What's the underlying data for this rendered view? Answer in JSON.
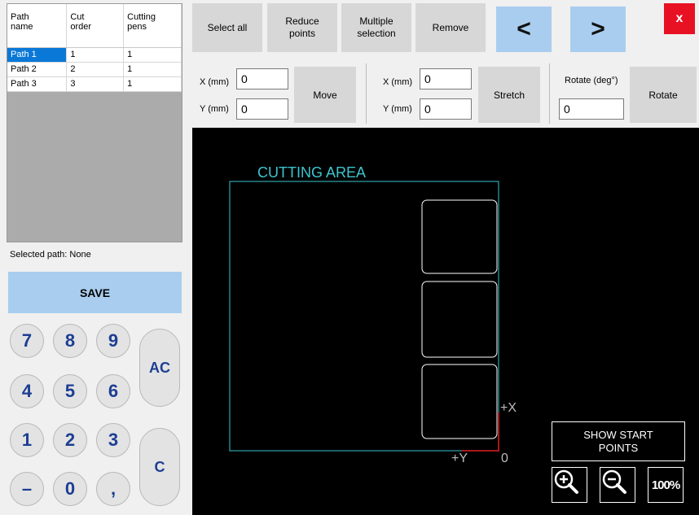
{
  "table": {
    "headers": [
      "Path\nname",
      "Cut\norder",
      "Cutting\npens"
    ],
    "rows": [
      [
        "Path 1",
        "1",
        "1"
      ],
      [
        "Path 2",
        "2",
        "1"
      ],
      [
        "Path 3",
        "3",
        "1"
      ]
    ],
    "selected_row": 0
  },
  "selected_path_text": "Selected path: None",
  "save_label": "SAVE",
  "keypad": {
    "keys": [
      "7",
      "8",
      "9",
      "4",
      "5",
      "6",
      "1",
      "2",
      "3",
      "–",
      "0",
      ","
    ],
    "ac": "AC",
    "c": "C"
  },
  "toolbar": {
    "select_all": "Select all",
    "reduce_points": "Reduce\npoints",
    "multiple_selection": "Multiple\nselection",
    "remove": "Remove",
    "prev": "<",
    "next": ">",
    "close": "x"
  },
  "move": {
    "x_label": "X (mm)",
    "y_label": "Y (mm)",
    "x_value": "0",
    "y_value": "0",
    "button": "Move"
  },
  "stretch": {
    "x_label": "X (mm)",
    "y_label": "Y (mm)",
    "x_value": "0",
    "y_value": "0",
    "button": "Stretch"
  },
  "rotate": {
    "label": "Rotate (deg°)",
    "value": "0",
    "button": "Rotate"
  },
  "canvas": {
    "title": "CUTTING AREA",
    "x_axis": "+X",
    "y_axis": "+Y",
    "origin": "0",
    "show_start_points": "SHOW START\nPOINTS",
    "zoom_100": "100%",
    "colors": {
      "cutting_area": "#3dc5d0",
      "paths": "#ffffff",
      "axis_marker": "#e32020"
    }
  }
}
